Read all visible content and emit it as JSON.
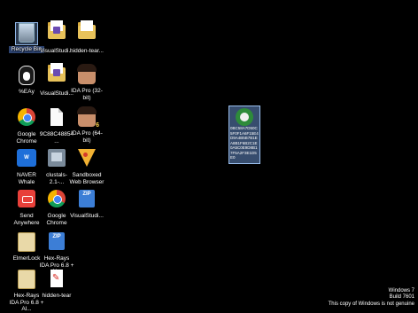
{
  "desktop": {
    "icons": [
      {
        "label": "Recycle Bin",
        "icon": "recycle-bin-icon"
      },
      {
        "label": "VisualStudi...",
        "icon": "folder-icon"
      },
      {
        "label": "hidden-tear...",
        "icon": "folder-icon"
      },
      {
        "label": "%EÄy",
        "icon": "penguin-icon"
      },
      {
        "label": "VisualStudi...",
        "icon": "folder-icon"
      },
      {
        "label": "IDA Pro (32-bit)",
        "icon": "ida-pro-icon"
      },
      {
        "label": "Google Chrome",
        "icon": "chrome-icon"
      },
      {
        "label": "9C88C48854...",
        "icon": "file-icon"
      },
      {
        "label": "IDA Pro (64-bit)",
        "icon": "ida-pro-icon"
      },
      {
        "label": "NAVER Whale",
        "icon": "whale-icon"
      },
      {
        "label": "clustals-2.1-...",
        "icon": "installer-icon"
      },
      {
        "label": "Sandboxed Web Browser",
        "icon": "pizza-icon"
      },
      {
        "label": "Send Anywhere",
        "icon": "send-anywhere-icon"
      },
      {
        "label": "Google Chrome",
        "icon": "chrome-icon"
      },
      {
        "label": "VisualStudi...",
        "icon": "zip-icon"
      },
      {
        "label": "ElmerLock",
        "icon": "elmerlock-icon"
      },
      {
        "label": "Hex-Rays IDA Pro 6.8 + Al...",
        "icon": "zip-icon"
      },
      {
        "label": "Hex-Rays IDA Pro 6.8 + Al...",
        "icon": "elmerlock-icon"
      },
      {
        "label": "hidden-tear",
        "icon": "pdf-icon"
      }
    ],
    "selected_file": {
      "label": "0BC58A7D50C5F0F1A6F15E4D9A4B5B7B1EA8B1F6B2C1E0A5C0E9D8B17F5A2F3E1D5E0",
      "icon": "frog-icon"
    }
  },
  "watermark": {
    "line1": "Windows 7",
    "line2": "Build 7601",
    "line3": "This copy of Windows is not genuine"
  }
}
